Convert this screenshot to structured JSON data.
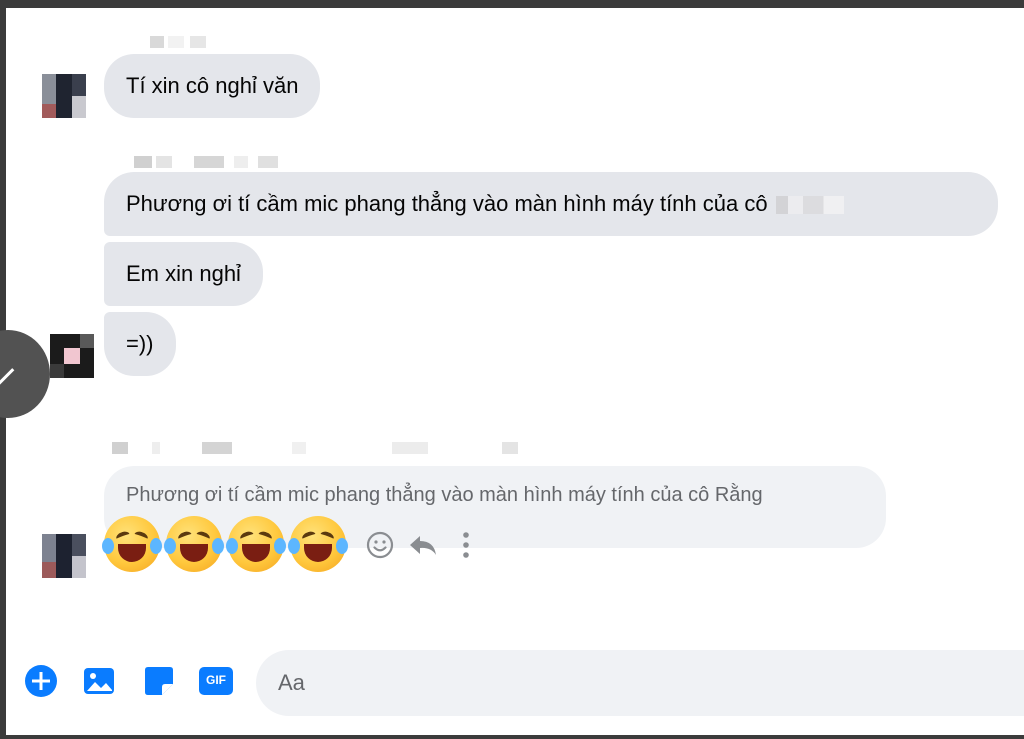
{
  "messages": [
    {
      "text": "Tí xin cô nghỉ văn"
    },
    {
      "text": "Phương ơi tí cầm mic phang thẳng vào màn hình máy tính của cô"
    },
    {
      "text": "Em xin nghỉ"
    },
    {
      "text": "=))"
    }
  ],
  "reply": {
    "quoted_text": "Phương ơi tí cầm mic phang thẳng vào màn hình máy tính của cô Rằng",
    "emojis": [
      "rolling-on-floor-laughing-emoji",
      "rolling-on-floor-laughing-emoji",
      "rolling-on-floor-laughing-emoji",
      "rolling-on-floor-laughing-emoji"
    ]
  },
  "message_actions": [
    "react-icon",
    "reply-icon",
    "more-options-icon"
  ],
  "composer": {
    "icons": [
      "plus-circle-icon",
      "image-icon",
      "sticker-icon",
      "gif-icon"
    ],
    "gif_label": "GIF",
    "placeholder": "Aa"
  },
  "colors": {
    "accent": "#0a7cff",
    "bubble": "#e4e6eb",
    "quote_bubble": "#f0f2f5",
    "muted_text": "#65676b"
  }
}
